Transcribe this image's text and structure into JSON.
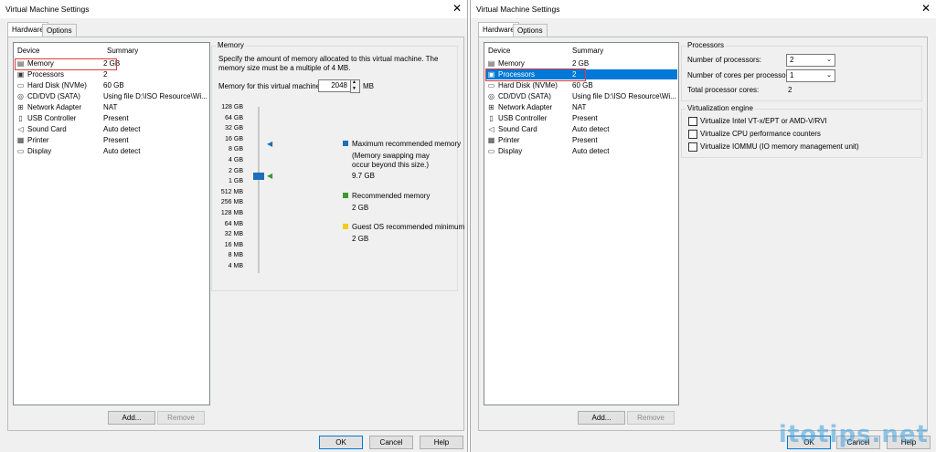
{
  "left": {
    "title": "Virtual Machine Settings",
    "tabs": [
      "Hardware",
      "Options"
    ],
    "device_header": "Device",
    "summary_header": "Summary",
    "devices": [
      {
        "icon": "memory-icon",
        "name": "Memory",
        "summary": "2 GB"
      },
      {
        "icon": "processor-icon",
        "name": "Processors",
        "summary": "2"
      },
      {
        "icon": "hard-disk-icon",
        "name": "Hard Disk (NVMe)",
        "summary": "60 GB"
      },
      {
        "icon": "cd-dvd-icon",
        "name": "CD/DVD (SATA)",
        "summary": "Using file D:\\ISO Resource\\Wi..."
      },
      {
        "icon": "network-adapter-icon",
        "name": "Network Adapter",
        "summary": "NAT"
      },
      {
        "icon": "usb-icon",
        "name": "USB Controller",
        "summary": "Present"
      },
      {
        "icon": "sound-card-icon",
        "name": "Sound Card",
        "summary": "Auto detect"
      },
      {
        "icon": "printer-icon",
        "name": "Printer",
        "summary": "Present"
      },
      {
        "icon": "display-icon",
        "name": "Display",
        "summary": "Auto detect"
      }
    ],
    "add_button": "Add...",
    "remove_button": "Remove",
    "memory": {
      "group_title": "Memory",
      "description": "Specify the amount of memory allocated to this virtual machine. The memory size must be a multiple of 4 MB.",
      "field_label": "Memory for this virtual machine:",
      "field_value": "2048",
      "unit": "MB",
      "scale": [
        "128 GB",
        "64 GB",
        "32 GB",
        "16 GB",
        "8 GB",
        "4 GB",
        "2 GB",
        "1 GB",
        "512 MB",
        "256 MB",
        "128 MB",
        "64 MB",
        "32 MB",
        "16 MB",
        "8 MB",
        "4 MB"
      ],
      "max_label": "Maximum recommended memory",
      "max_note": "(Memory swapping may occur beyond this size.)",
      "max_value": "9.7 GB",
      "rec_label": "Recommended memory",
      "rec_value": "2 GB",
      "min_label": "Guest OS recommended minimum",
      "min_value": "2 GB",
      "colors": {
        "max": "#1e6fb8",
        "rec": "#3a9a2c",
        "min": "#f2cc1d"
      }
    },
    "ok": "OK",
    "cancel": "Cancel",
    "help": "Help"
  },
  "right": {
    "title": "Virtual Machine Settings",
    "tabs": [
      "Hardware",
      "Options"
    ],
    "device_header": "Device",
    "summary_header": "Summary",
    "devices": [
      {
        "icon": "memory-icon",
        "name": "Memory",
        "summary": "2 GB"
      },
      {
        "icon": "processor-icon",
        "name": "Processors",
        "summary": "2"
      },
      {
        "icon": "hard-disk-icon",
        "name": "Hard Disk (NVMe)",
        "summary": "60 GB"
      },
      {
        "icon": "cd-dvd-icon",
        "name": "CD/DVD (SATA)",
        "summary": "Using file D:\\ISO Resource\\Wi..."
      },
      {
        "icon": "network-adapter-icon",
        "name": "Network Adapter",
        "summary": "NAT"
      },
      {
        "icon": "usb-icon",
        "name": "USB Controller",
        "summary": "Present"
      },
      {
        "icon": "sound-card-icon",
        "name": "Sound Card",
        "summary": "Auto detect"
      },
      {
        "icon": "printer-icon",
        "name": "Printer",
        "summary": "Present"
      },
      {
        "icon": "display-icon",
        "name": "Display",
        "summary": "Auto detect"
      }
    ],
    "add_button": "Add...",
    "remove_button": "Remove",
    "processors": {
      "group_title": "Processors",
      "num_processors_label": "Number of processors:",
      "num_processors_value": "2",
      "cores_label": "Number of cores per processor:",
      "cores_value": "1",
      "total_label": "Total processor cores:",
      "total_value": "2"
    },
    "virtualization": {
      "group_title": "Virtualization engine",
      "options": [
        "Virtualize Intel VT-x/EPT or AMD-V/RVI",
        "Virtualize CPU performance counters",
        "Virtualize IOMMU (IO memory management unit)"
      ]
    },
    "ok": "OK",
    "cancel": "Cancel",
    "help": "Help",
    "watermark": "itotips.net"
  }
}
